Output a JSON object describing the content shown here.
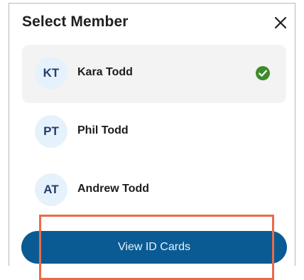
{
  "dialog": {
    "title": "Select Member",
    "close_icon": "close-icon"
  },
  "members": [
    {
      "initials": "KT",
      "name": "Kara Todd",
      "selected": true
    },
    {
      "initials": "PT",
      "name": "Phil Todd",
      "selected": false
    },
    {
      "initials": "AT",
      "name": "Andrew Todd",
      "selected": false
    }
  ],
  "selected_icon": "check-circle-icon",
  "button": {
    "label": "View ID Cards"
  },
  "colors": {
    "button_bg": "#0a5b93",
    "avatar_bg": "#e6f2fb",
    "avatar_text": "#243d6b",
    "selected_row_bg": "#f3f3f3",
    "check_green": "#3f8a2c",
    "highlight_box": "#ea6b4a"
  }
}
